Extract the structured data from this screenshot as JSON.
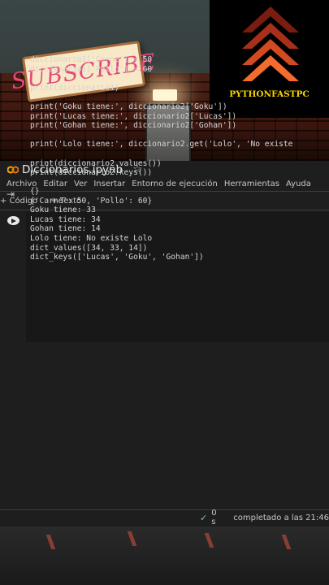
{
  "promo": {
    "subscribe_text": "SUBSCRIBE",
    "brand": "PYTHONFASTPC"
  },
  "notebook": {
    "title": "Diccionarios.ipynb"
  },
  "menu": [
    "Archivo",
    "Editar",
    "Ver",
    "Insertar",
    "Entorno de ejecución",
    "Herramientas",
    "Ayuda"
  ],
  "toolbar": {
    "add_code": "+ Código",
    "add_text": "+ Texto"
  },
  "cell": {
    "code_lines": [
      "diccionario1['Carne'] = 50",
      "diccionario1['Pollo'] = 60",
      "",
      "print(diccionario1)",
      "",
      "print('Goku tiene:', diccionario2['Goku'])",
      "print('Lucas tiene:', diccionario2['Lucas'])",
      "print('Gohan tiene:', diccionario2['Gohan'])",
      "",
      "print('Lolo tiene:', diccionario2.get('Lolo', 'No existe",
      "",
      "print(diccionario2.values())",
      "print(diccionario2.keys())"
    ],
    "output_lines": [
      "{}",
      "{'Carne': 50, 'Pollo': 60}",
      "Goku tiene: 33",
      "Lucas tiene: 34",
      "Gohan tiene: 14",
      "Lolo tiene: No existe Lolo",
      "dict_values([34, 33, 14])",
      "dict_keys(['Lucas', 'Goku', 'Gohan'])"
    ]
  },
  "status": {
    "duration": "0 s",
    "completed": "completado a las 21:46"
  }
}
